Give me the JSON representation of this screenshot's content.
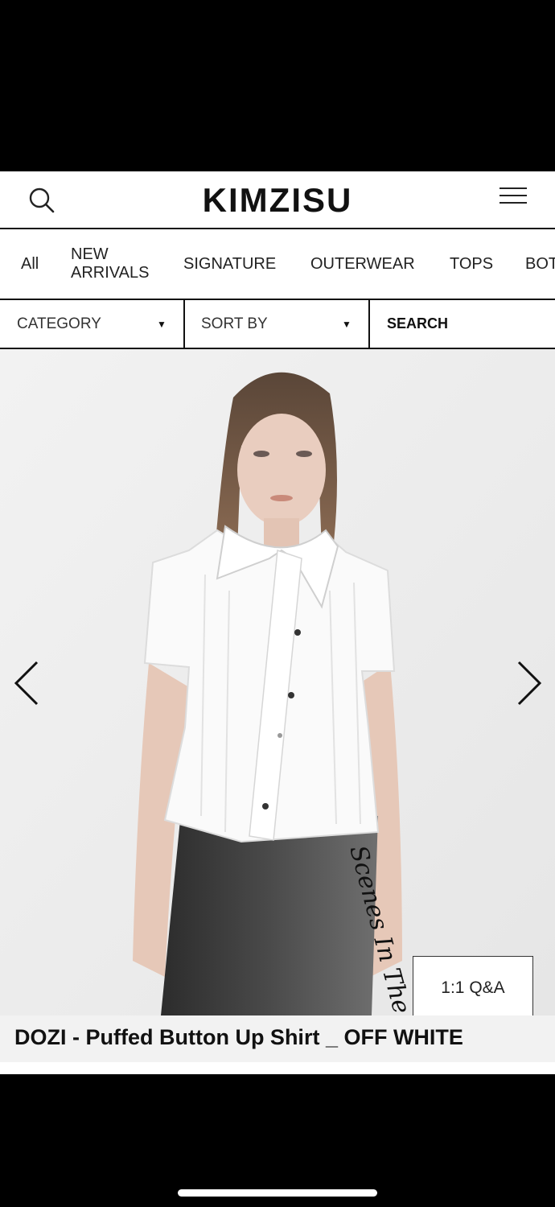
{
  "header": {
    "brand": "KIMZISU"
  },
  "tabs": [
    {
      "label": "All"
    },
    {
      "label": "NEW ARRIVALS"
    },
    {
      "label": "SIGNATURE"
    },
    {
      "label": "OUTERWEAR"
    },
    {
      "label": "TOPS"
    },
    {
      "label": "BOT"
    }
  ],
  "filters": {
    "category_label": "CATEGORY",
    "sort_label": "SORT BY",
    "search_label": "SEARCH"
  },
  "product": {
    "title": "DOZI - Puffed Button Up Shirt _ OFF WHITE",
    "qa_label": "1:1 Q&A",
    "skirt_script": "Scenes In The Ste"
  },
  "colors": {
    "background": "#000000",
    "surface": "#ffffff",
    "photo_bg": "#eeeeee",
    "text": "#111111"
  }
}
